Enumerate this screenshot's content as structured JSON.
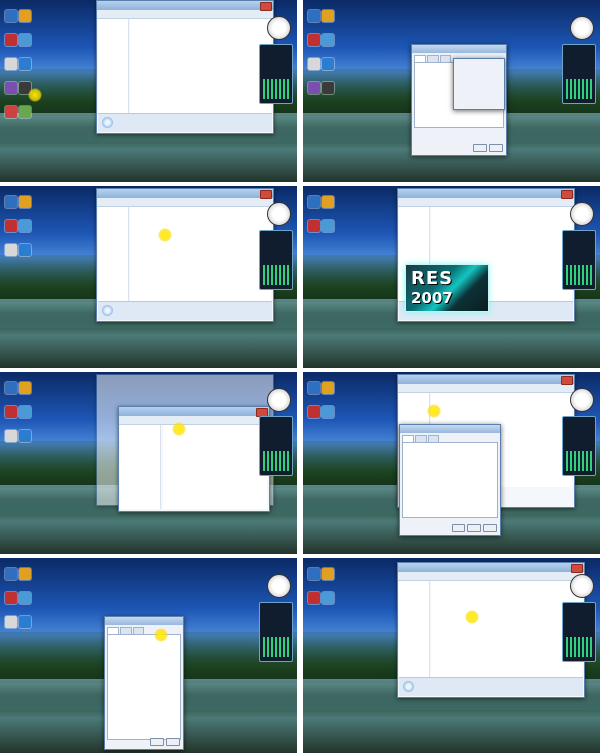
{
  "res": {
    "name": "RES",
    "year": "2007"
  },
  "colors": {
    "highlight": "#ffe000",
    "window_border": "#5b7fab",
    "selection": "#cde3fa"
  },
  "icons": [
    "app-icon",
    "folder-icon",
    "gadget-clock-icon",
    "gadget-meter-icon"
  ]
}
